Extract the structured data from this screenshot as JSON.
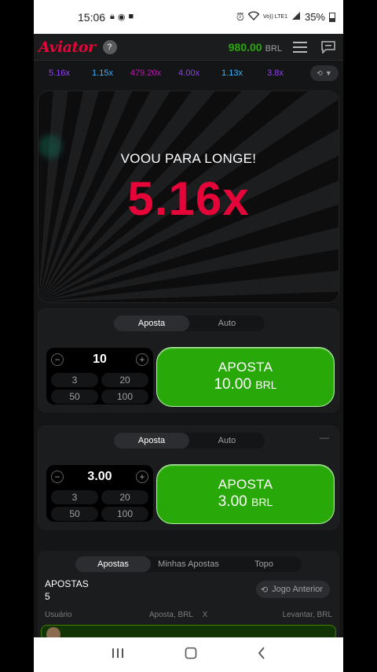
{
  "status": {
    "time": "15:06",
    "battery": "35%",
    "network": "Vo)) LTE1"
  },
  "header": {
    "logo": "Aviator",
    "help": "?",
    "balance": "980.00",
    "currency": "BRL"
  },
  "history": [
    "5.16x",
    "1.15x",
    "479.20x",
    "4.00x",
    "1.13x",
    "3.8x"
  ],
  "history_colors": [
    "#913ef8",
    "#34b4ff",
    "#c017b4",
    "#913ef8",
    "#34b4ff",
    "#913ef8"
  ],
  "game": {
    "message": "VOOU PARA LONGE!",
    "multiplier": "5.16x"
  },
  "bet1": {
    "tab_bet": "Aposta",
    "tab_auto": "Auto",
    "stake": "10",
    "quick": [
      "3",
      "20",
      "50",
      "100"
    ],
    "btn_label": "APOSTA",
    "btn_amount": "10.00",
    "btn_currency": "BRL"
  },
  "bet2": {
    "tab_bet": "Aposta",
    "tab_auto": "Auto",
    "stake": "3.00",
    "quick": [
      "3",
      "20",
      "50",
      "100"
    ],
    "btn_label": "APOSTA",
    "btn_amount": "3.00",
    "btn_currency": "BRL"
  },
  "bets": {
    "tabs": [
      "Apostas",
      "Minhas Apostas",
      "Topo"
    ],
    "title": "APOSTAS",
    "count": "5",
    "prev": "Jogo Anterior",
    "columns": [
      "Usuário",
      "Aposta, BRL",
      "X",
      "Levantar, BRL"
    ]
  },
  "colors": {
    "accent_red": "#e50539",
    "green": "#28a909"
  }
}
